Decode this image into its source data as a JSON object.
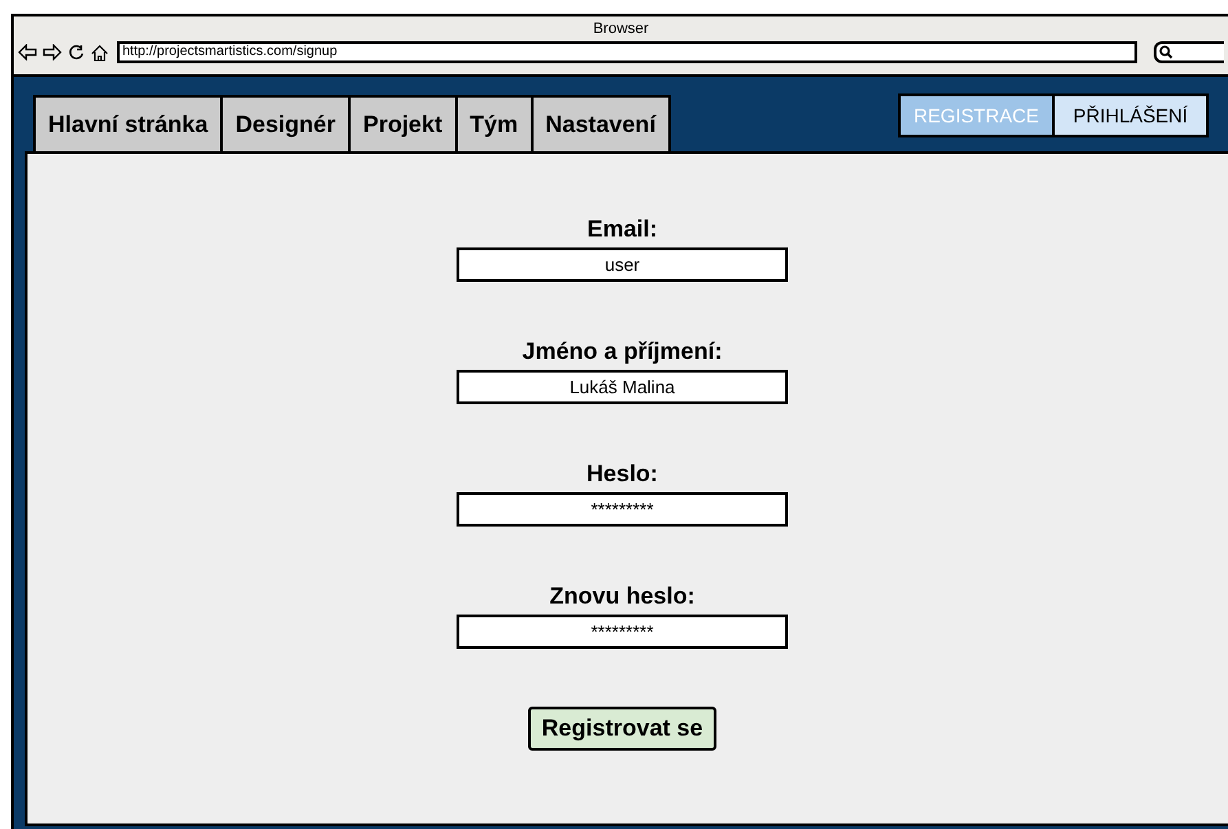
{
  "window": {
    "title": "Browser"
  },
  "address_bar": {
    "url": "http://projectsmartistics.com/signup"
  },
  "nav_tabs": [
    {
      "label": "Hlavní stránka"
    },
    {
      "label": "Designér"
    },
    {
      "label": "Projekt"
    },
    {
      "label": "Tým"
    },
    {
      "label": "Nastavení"
    }
  ],
  "auth_buttons": [
    {
      "label": "REGISTRACE",
      "selected": true
    },
    {
      "label": "PŘIHLÁŠENÍ",
      "selected": false
    }
  ],
  "form": {
    "fields": [
      {
        "label": "Email:",
        "value": "user"
      },
      {
        "label": "Jméno a příjmení:",
        "value": "Lukáš Malina"
      },
      {
        "label": "Heslo:",
        "value": "*********"
      },
      {
        "label": "Znovu heslo:",
        "value": "*********"
      }
    ],
    "submit": "Registrovat se"
  }
}
